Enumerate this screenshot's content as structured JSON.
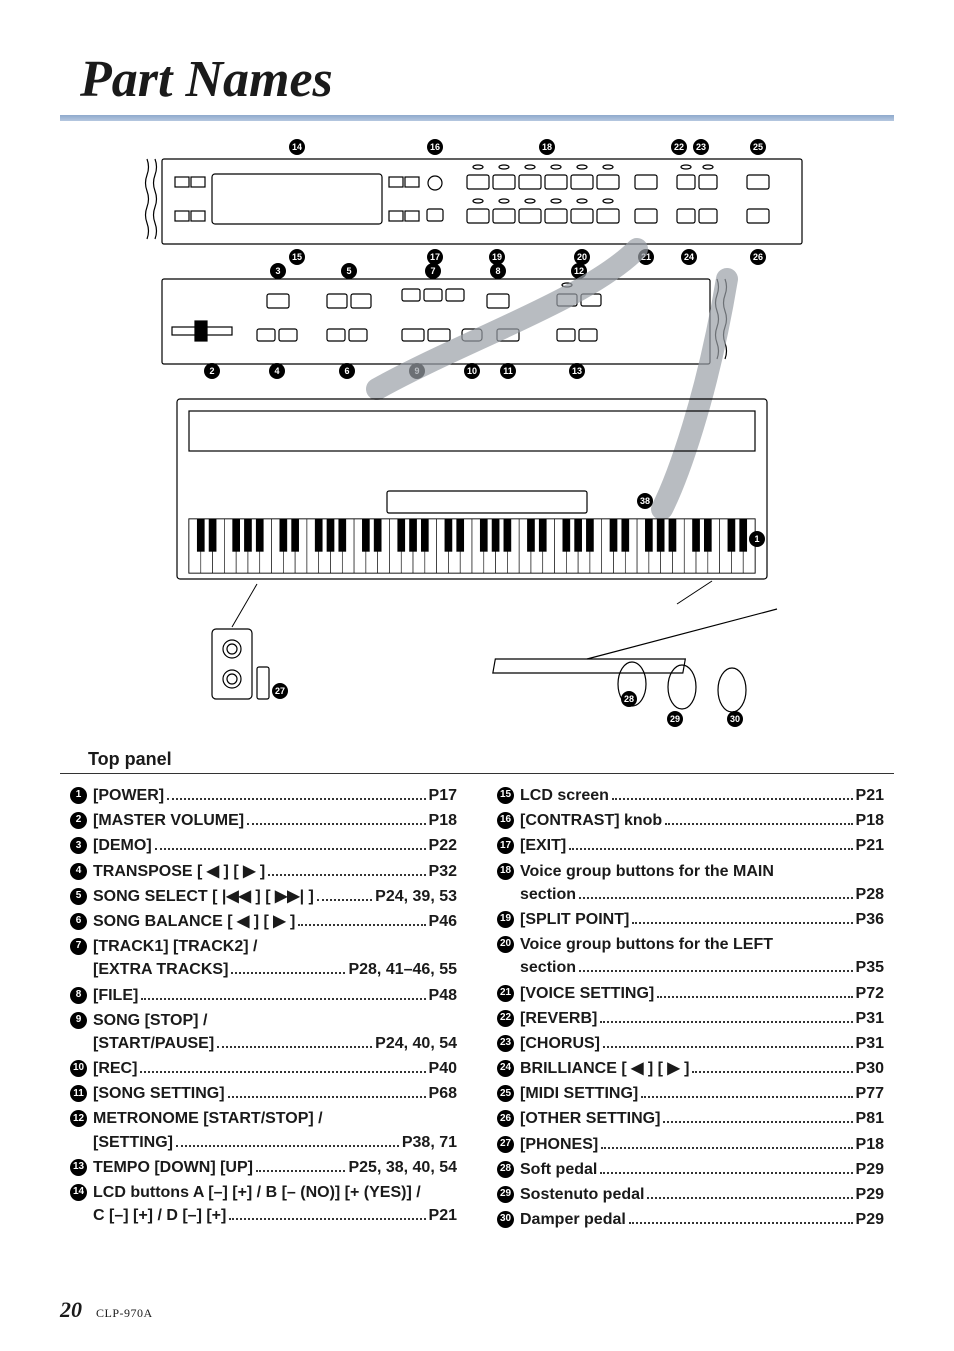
{
  "page": {
    "title": "Part Names",
    "section_heading": "Top panel",
    "page_number": "20",
    "model": "CLP-970A"
  },
  "left_column": [
    {
      "num": "1",
      "lines": [
        {
          "text": "[POWER]",
          "page": "P17"
        }
      ]
    },
    {
      "num": "2",
      "lines": [
        {
          "text": "[MASTER VOLUME]",
          "page": "P18"
        }
      ]
    },
    {
      "num": "3",
      "lines": [
        {
          "text": "[DEMO]",
          "page": "P22"
        }
      ]
    },
    {
      "num": "4",
      "lines": [
        {
          "text": "TRANSPOSE [ ◀ ] [ ▶ ]",
          "page": "P32"
        }
      ]
    },
    {
      "num": "5",
      "lines": [
        {
          "text": "SONG SELECT [ |◀◀ ] [ ▶▶| ]",
          "page": "P24, 39, 53"
        }
      ]
    },
    {
      "num": "6",
      "lines": [
        {
          "text": "SONG BALANCE [ ◀ ] [ ▶ ]",
          "page": "P46"
        }
      ]
    },
    {
      "num": "7",
      "lines": [
        {
          "text": "[TRACK1] [TRACK2] /",
          "page": null
        },
        {
          "text": "[EXTRA TRACKS]",
          "page": "P28, 41–46, 55"
        }
      ]
    },
    {
      "num": "8",
      "lines": [
        {
          "text": "[FILE]",
          "page": "P48"
        }
      ]
    },
    {
      "num": "9",
      "lines": [
        {
          "text": "SONG [STOP] /",
          "page": null
        },
        {
          "text": "[START/PAUSE]",
          "page": "P24, 40, 54"
        }
      ]
    },
    {
      "num": "10",
      "lines": [
        {
          "text": "[REC]",
          "page": "P40"
        }
      ]
    },
    {
      "num": "11",
      "lines": [
        {
          "text": "[SONG SETTING]",
          "page": "P68"
        }
      ]
    },
    {
      "num": "12",
      "lines": [
        {
          "text": "METRONOME [START/STOP] /",
          "page": null
        },
        {
          "text": "[SETTING]",
          "page": "P38, 71"
        }
      ]
    },
    {
      "num": "13",
      "lines": [
        {
          "text": "TEMPO [DOWN] [UP]",
          "page": "P25, 38, 40, 54"
        }
      ]
    },
    {
      "num": "14",
      "lines": [
        {
          "text": "LCD buttons A [–] [+] / B [– (NO)] [+ (YES)] /",
          "page": null
        },
        {
          "text": "C [–] [+] / D [–] [+]",
          "page": "P21"
        }
      ]
    }
  ],
  "right_column": [
    {
      "num": "15",
      "lines": [
        {
          "text": "LCD screen",
          "page": "P21"
        }
      ]
    },
    {
      "num": "16",
      "lines": [
        {
          "text": "[CONTRAST] knob",
          "page": "P18"
        }
      ]
    },
    {
      "num": "17",
      "lines": [
        {
          "text": "[EXIT]",
          "page": "P21"
        }
      ]
    },
    {
      "num": "18",
      "lines": [
        {
          "text": "Voice group buttons for the MAIN",
          "page": null
        },
        {
          "text": "section",
          "page": "P28"
        }
      ]
    },
    {
      "num": "19",
      "lines": [
        {
          "text": "[SPLIT POINT]",
          "page": "P36"
        }
      ]
    },
    {
      "num": "20",
      "lines": [
        {
          "text": "Voice group buttons for the LEFT",
          "page": null
        },
        {
          "text": "section",
          "page": "P35"
        }
      ]
    },
    {
      "num": "21",
      "lines": [
        {
          "text": "[VOICE SETTING]",
          "page": "P72"
        }
      ]
    },
    {
      "num": "22",
      "lines": [
        {
          "text": "[REVERB]",
          "page": "P31"
        }
      ]
    },
    {
      "num": "23",
      "lines": [
        {
          "text": "[CHORUS]",
          "page": "P31"
        }
      ]
    },
    {
      "num": "24",
      "lines": [
        {
          "text": "BRILLIANCE [ ◀ ] [ ▶ ]",
          "page": "P30"
        }
      ]
    },
    {
      "num": "25",
      "lines": [
        {
          "text": "[MIDI SETTING]",
          "page": "P77"
        }
      ]
    },
    {
      "num": "26",
      "lines": [
        {
          "text": "[OTHER SETTING]",
          "page": "P81"
        }
      ]
    },
    {
      "num": "27",
      "lines": [
        {
          "text": "[PHONES]",
          "page": "P18"
        }
      ]
    },
    {
      "num": "28",
      "lines": [
        {
          "text": "Soft pedal",
          "page": "P29"
        }
      ]
    },
    {
      "num": "29",
      "lines": [
        {
          "text": "Sostenuto pedal",
          "page": "P29"
        }
      ]
    },
    {
      "num": "30",
      "lines": [
        {
          "text": "Damper pedal",
          "page": "P29"
        }
      ]
    }
  ],
  "diagram_callouts_top": [
    "14",
    "16",
    "18",
    "22",
    "23",
    "25"
  ],
  "diagram_callouts_top2": [
    "15",
    "17",
    "19",
    "20",
    "21",
    "24",
    "26"
  ],
  "diagram_callouts_mid_top": [
    "3",
    "5",
    "7",
    "8",
    "12"
  ],
  "diagram_callouts_mid_bot": [
    "2",
    "4",
    "6",
    "9",
    "10",
    "11",
    "13"
  ],
  "diagram_callouts_piano": [
    "1",
    "38"
  ],
  "diagram_callouts_jack": [
    "27"
  ],
  "diagram_callouts_pedal": [
    "28",
    "29",
    "30"
  ]
}
